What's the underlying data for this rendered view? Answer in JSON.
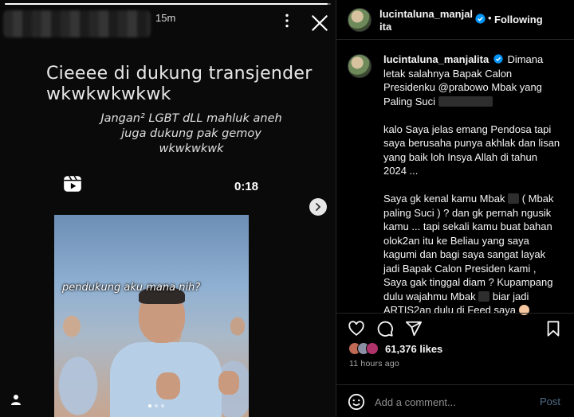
{
  "story": {
    "time": "15m",
    "progress": 0.99,
    "caption_line1": "Cieeee di dukung transjender wkwkwkwkwk",
    "caption_line2": "Jangan² LGBT dLL  mahluk aneh juga dukung pak gemoy wkwkwkwk",
    "duration": "0:18",
    "video_caption": "pendukung aku mana nih?",
    "icons": {
      "more": "more-horizontal-icon",
      "close": "close-icon",
      "reels": "reels-icon",
      "next": "chevron-right-icon",
      "user_tag": "user-tag-icon"
    }
  },
  "post": {
    "username": "lucintaluna_manjalita",
    "follow_state": "Following",
    "separator": "•",
    "caption": {
      "username": "lucintaluna_manjalita",
      "p1": "Dimana letak salahnya Bapak Calon Presidenku @prabowo Mbak yang Paling Suci",
      "p2": "kalo Saya jelas emang Pendosa tapi saya berusaha punya akhlak dan lisan yang baik loh Insya Allah di tahun 2024 ...",
      "p3_a": "Saya gk kenal kamu Mbak",
      "p3_b": "( Mbak paling Suci ) ? dan gk pernah ngusik kamu ... tapi sekali kamu buat bahan olok2an itu ke Beliau yang saya kagumi dan bagi saya sangat layak jadi Bapak Calon Presiden kami , Saya gak tinggal diam ? Kupampang dulu wajahmu Mbak",
      "p3_c": "biar jadi ARTIS2an dulu di Feed saya"
    },
    "likes": "61,376 likes",
    "age": "11 hours ago",
    "comment_placeholder": "Add a comment...",
    "post_label": "Post",
    "icons": {
      "verified": "verified-badge-icon",
      "like": "heart-icon",
      "comment": "comment-icon",
      "share": "share-icon",
      "save": "bookmark-icon",
      "emoji": "emoji-icon"
    },
    "colors": {
      "verified": "#0095f6",
      "post_button": "#4f6d87"
    }
  }
}
